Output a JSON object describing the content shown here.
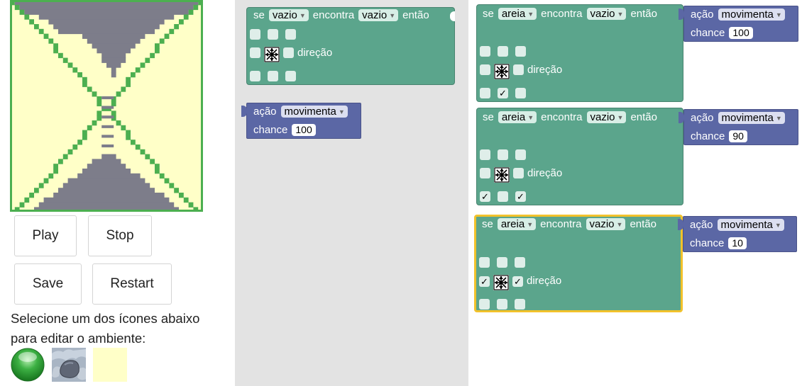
{
  "buttons": {
    "play": "Play",
    "stop": "Stop",
    "save": "Save",
    "restart": "Restart"
  },
  "instructions": {
    "line1": "Selecione um dos ícones abaixo",
    "line2": "para editar o ambiente:"
  },
  "palette": [
    {
      "name": "green-ball",
      "color": "#3cb043"
    },
    {
      "name": "stone",
      "color": "#8a96a6"
    },
    {
      "name": "empty",
      "color": "#ffffc8"
    }
  ],
  "simulation": {
    "colors": {
      "background": "#ffffc8",
      "wall": "#4caf50",
      "sand": "#7d7d8a"
    }
  },
  "labels": {
    "se": "se",
    "encontra": "encontra",
    "entao": "então",
    "direcao": "direção",
    "acao": "ação",
    "chance": "chance",
    "check": "✓"
  },
  "rules": [
    {
      "subject": "vazio",
      "target": "vazio",
      "checks": [
        false,
        false,
        false,
        false,
        false,
        false,
        false,
        false
      ],
      "action": {
        "type": "movimenta",
        "chance": "100"
      }
    },
    {
      "subject": "areia",
      "target": "vazio",
      "checks": [
        false,
        false,
        false,
        false,
        false,
        false,
        true,
        false
      ],
      "action": {
        "type": "movimenta",
        "chance": "100"
      }
    },
    {
      "subject": "areia",
      "target": "vazio",
      "checks": [
        false,
        false,
        false,
        false,
        false,
        true,
        false,
        true
      ],
      "action": {
        "type": "movimenta",
        "chance": "90"
      }
    },
    {
      "subject": "areia",
      "target": "vazio",
      "checks": [
        false,
        false,
        false,
        true,
        true,
        false,
        false,
        false
      ],
      "action": {
        "type": "movimenta",
        "chance": "10"
      }
    }
  ]
}
